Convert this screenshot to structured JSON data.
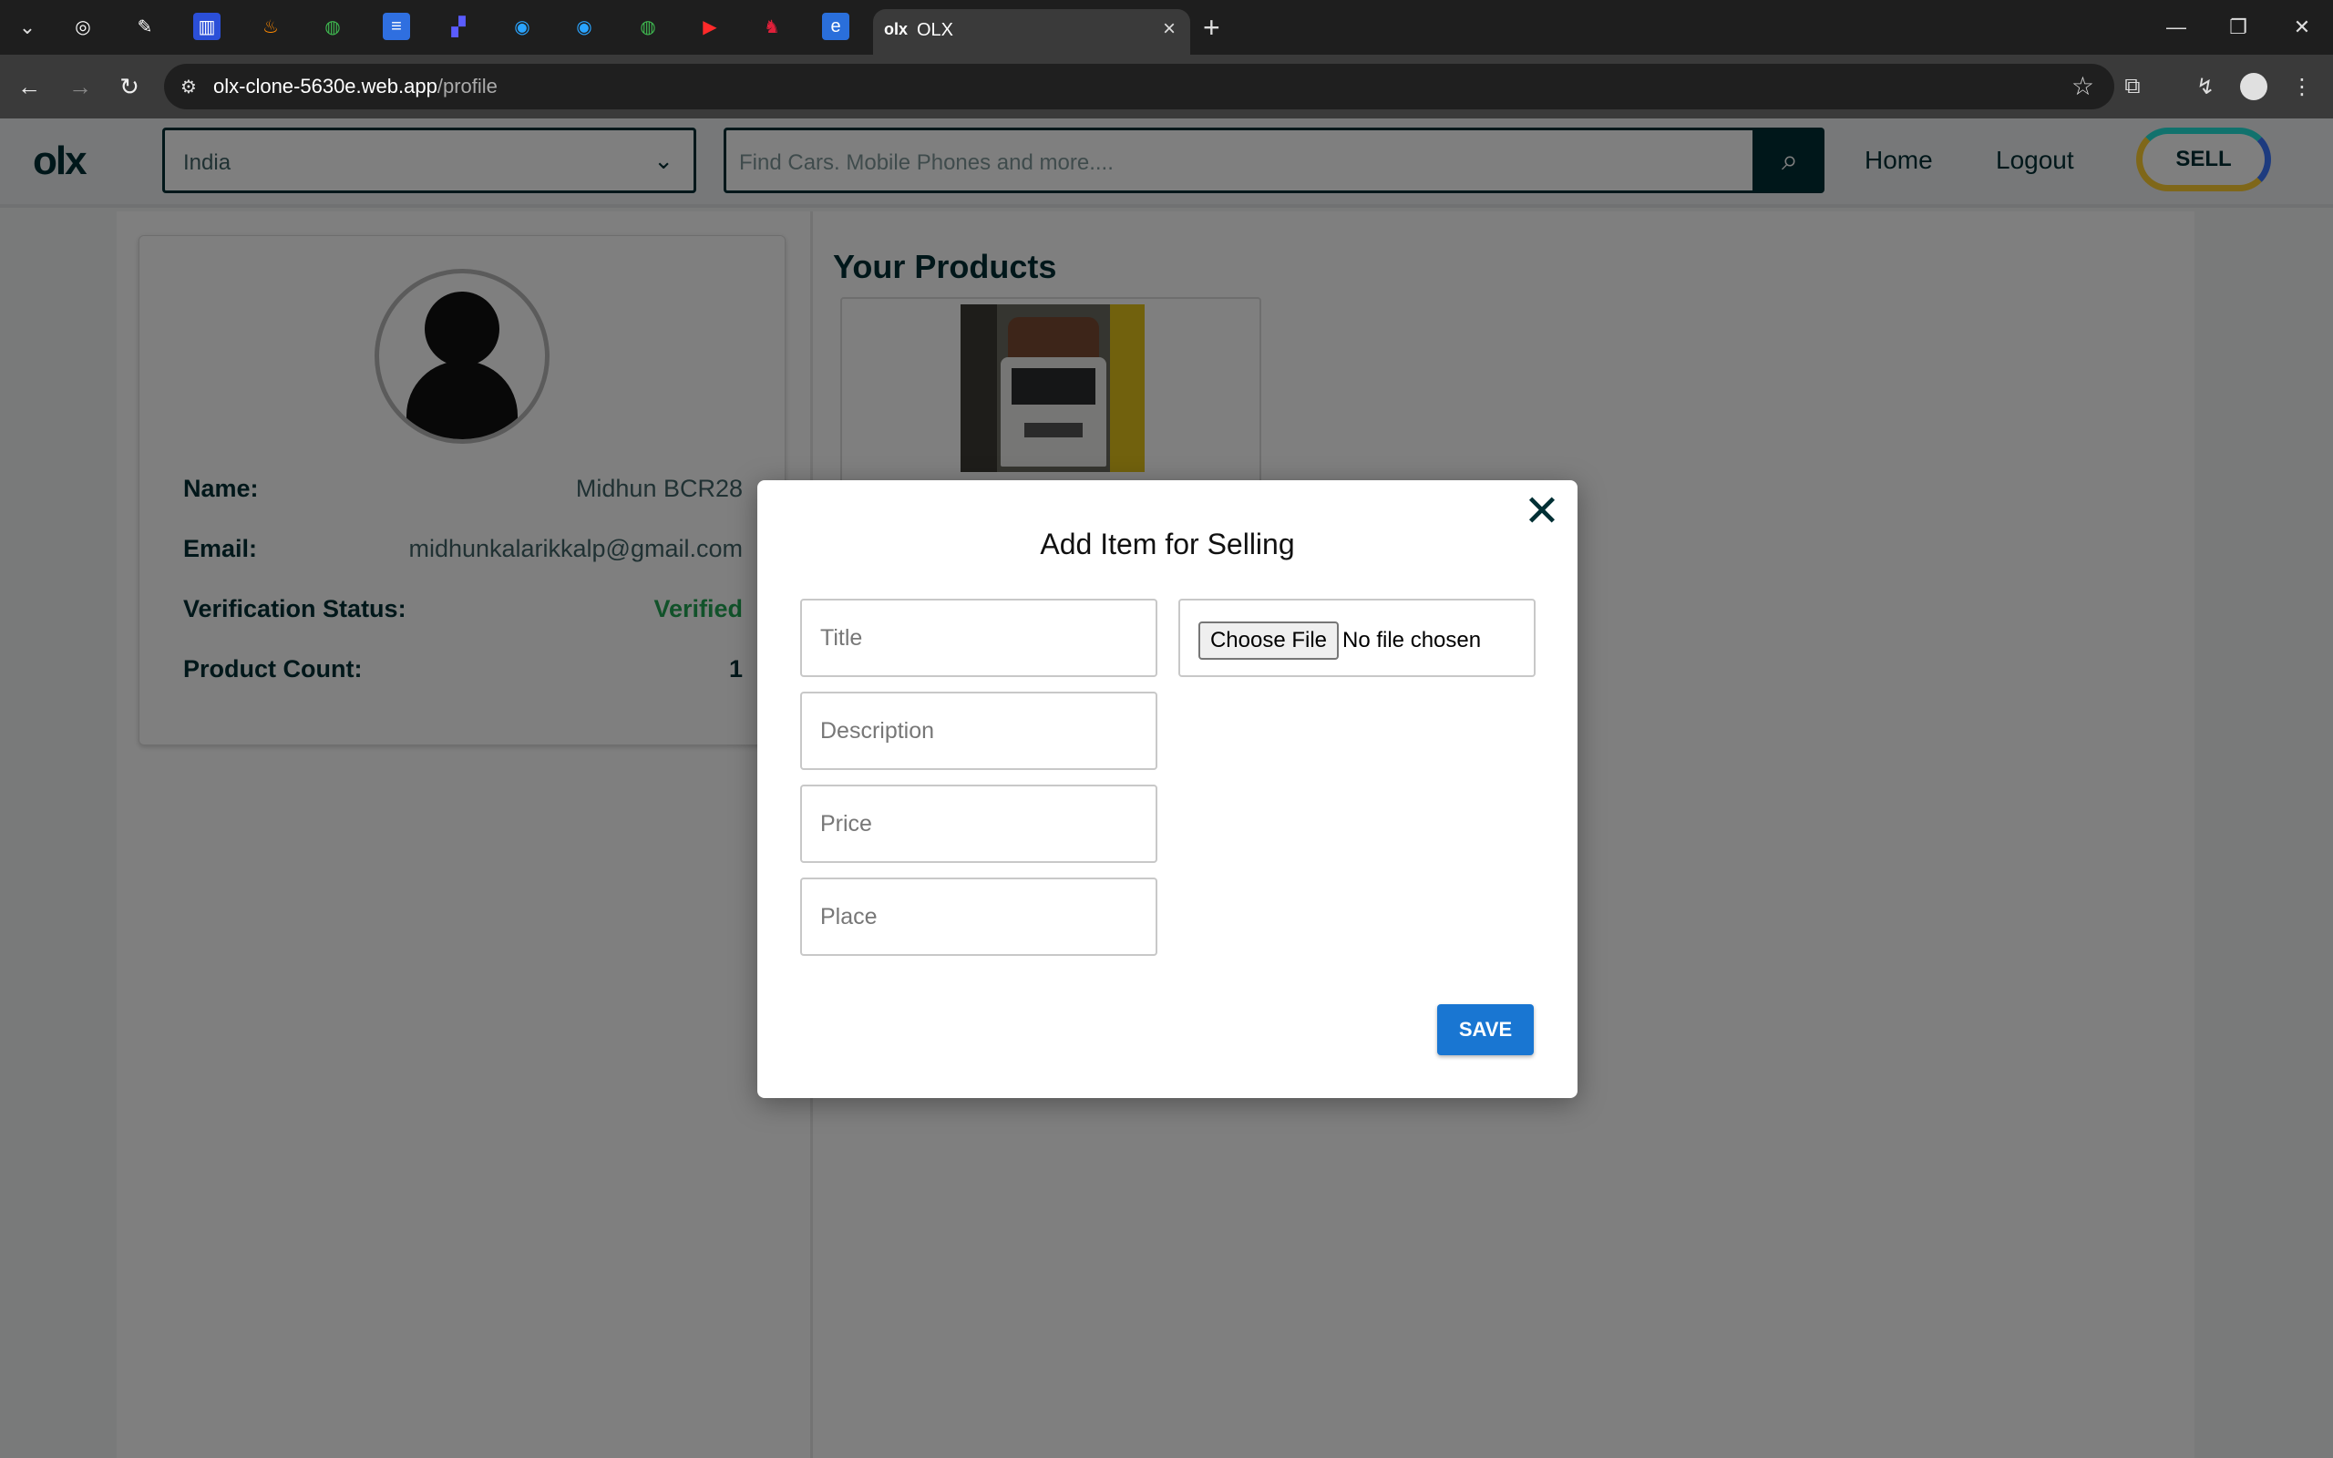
{
  "browser": {
    "tabs": [
      "threads-icon",
      "patch-icon",
      "nms-icon",
      "firebase-icon",
      "globe-icon",
      "docs-icon",
      "linear-icon",
      "chrome-app-icon",
      "chrome-app-icon",
      "globe-icon",
      "youtube-icon",
      "dog-icon",
      "extension-app-icon"
    ],
    "active_tab": {
      "logo": "olx",
      "title": "OLX"
    },
    "url_host": "olx-clone-5630e.web.app",
    "url_path": "/profile"
  },
  "header": {
    "logo": "olx",
    "country": "India",
    "search_placeholder": "Find Cars. Mobile Phones and more....",
    "nav": {
      "home": "Home",
      "logout": "Logout"
    },
    "sell": "SELL"
  },
  "profile": {
    "name_label": "Name:",
    "name_value": "Midhun BCR28",
    "email_label": "Email:",
    "email_value": "midhunkalarikkalp@gmail.com",
    "status_label": "Verification Status:",
    "status_value": "Verified",
    "count_label": "Product Count:",
    "count_value": "1",
    "status_color": "#23a455"
  },
  "products": {
    "title": "Your Products"
  },
  "modal": {
    "title": "Add Item for Selling",
    "fields": {
      "title_placeholder": "Title",
      "description_placeholder": "Description",
      "price_placeholder": "Price",
      "place_placeholder": "Place"
    },
    "file_button": "Choose File",
    "file_status": "No file chosen",
    "save": "SAVE",
    "save_color": "#1976d2"
  }
}
